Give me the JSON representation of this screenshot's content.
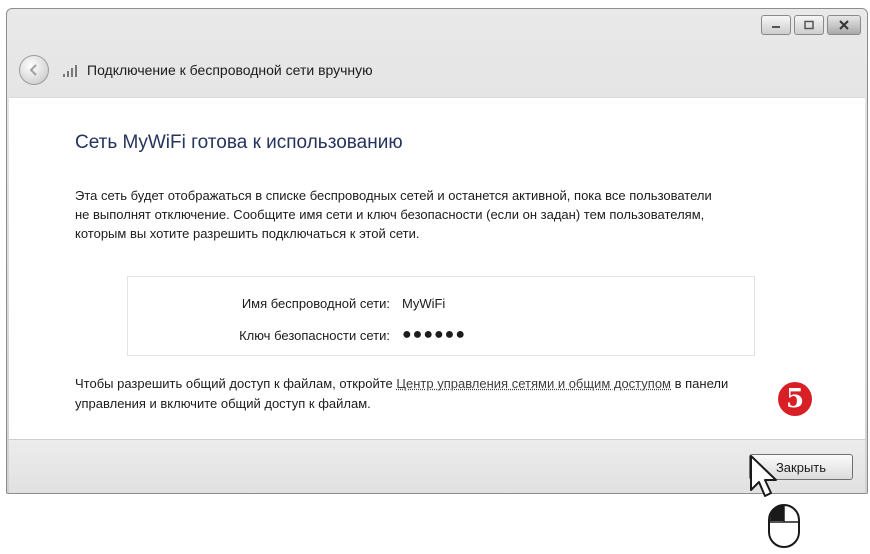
{
  "window": {
    "title": "Подключение к беспроводной сети вручную",
    "controls": [
      "minimize-icon",
      "maximize-icon",
      "close-icon"
    ]
  },
  "content": {
    "heading": "Сеть MyWiFi готова к использованию",
    "description": "Эта сеть будет отображаться в списке беспроводных сетей и останется активной, пока все пользователи не выполнят отключение. Сообщите имя сети и ключ безопасности (если он задан) тем пользователям, которым вы хотите разрешить подключаться к этой сети.",
    "network_name_label": "Имя беспроводной сети:",
    "network_name_value": "MyWiFi",
    "security_key_label": "Ключ безопасности сети:",
    "security_key_value": "●●●●●●",
    "sharing_text_before": "Чтобы разрешить общий доступ к файлам, откройте ",
    "sharing_link": "Центр управления сетями и общим доступом",
    "sharing_text_after": " в панели управления и включите общий доступ к файлам."
  },
  "footer": {
    "close_label": "Закрыть"
  },
  "annotation": {
    "step_number": "5"
  },
  "icons": {
    "back": "back-arrow-icon",
    "network": "wireless-signal-icon",
    "cursor": "mouse-pointer-icon",
    "mouse": "computer-mouse-icon"
  },
  "colors": {
    "heading": "#26345c",
    "badge": "#d81f26"
  }
}
